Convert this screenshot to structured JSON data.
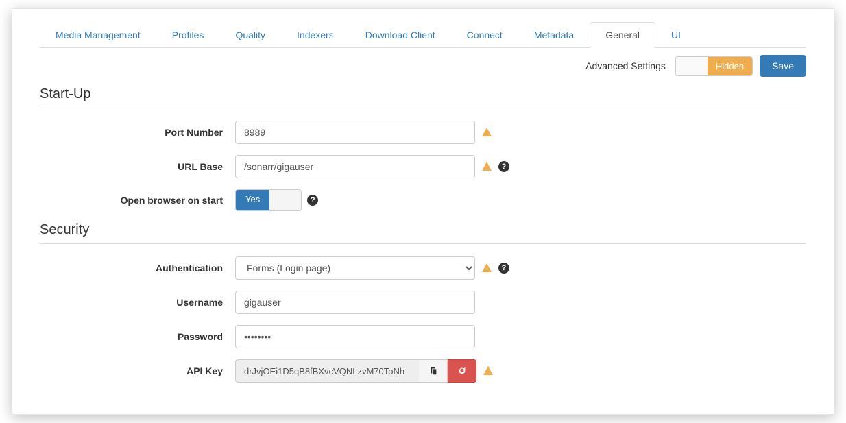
{
  "tabs": [
    {
      "label": "Media Management"
    },
    {
      "label": "Profiles"
    },
    {
      "label": "Quality"
    },
    {
      "label": "Indexers"
    },
    {
      "label": "Download Client"
    },
    {
      "label": "Connect"
    },
    {
      "label": "Metadata"
    },
    {
      "label": "General"
    },
    {
      "label": "UI"
    }
  ],
  "toolbar": {
    "advanced_label": "Advanced Settings",
    "hidden_label": "Hidden",
    "save_label": "Save"
  },
  "sections": {
    "startup": {
      "title": "Start-Up",
      "port_label": "Port Number",
      "port_value": "8989",
      "urlbase_label": "URL Base",
      "urlbase_value": "/sonarr/gigauser",
      "openbrowser_label": "Open browser on start",
      "openbrowser_on": "Yes"
    },
    "security": {
      "title": "Security",
      "auth_label": "Authentication",
      "auth_value": "Forms (Login page)",
      "username_label": "Username",
      "username_value": "gigauser",
      "password_label": "Password",
      "password_value": "••••••••",
      "apikey_label": "API Key",
      "apikey_value": "drJvjOEi1D5qB8fBXvcVQNLzvM70ToNh"
    }
  },
  "icons": {
    "warning": "warning-triangle",
    "help": "?",
    "copy": "copy",
    "refresh": "refresh"
  }
}
